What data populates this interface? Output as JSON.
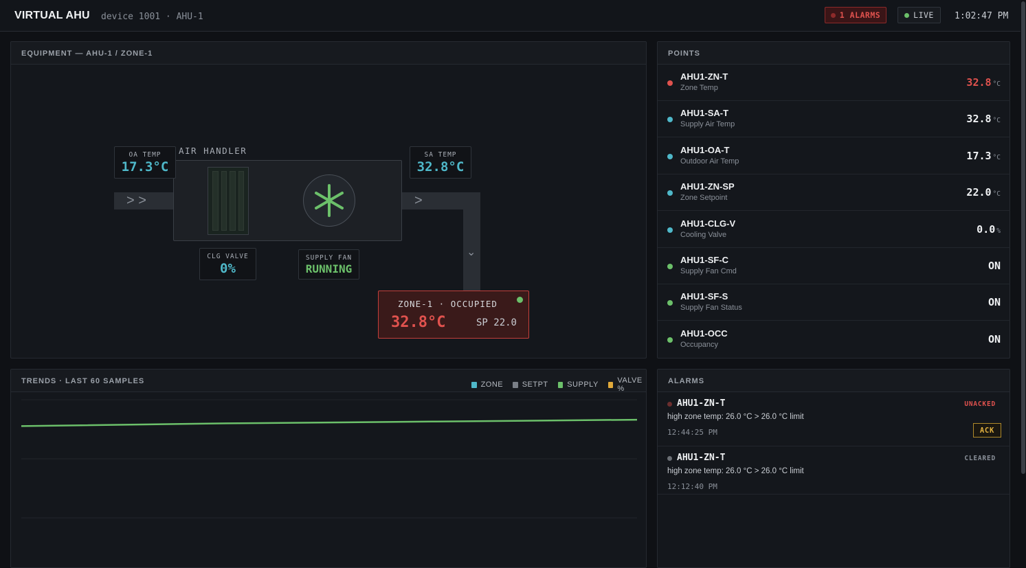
{
  "header": {
    "brand": "VIRTUAL AHU",
    "device": "device 1001 · AHU-1",
    "alarm_pill": "1 ALARMS",
    "live_pill": "LIVE",
    "clock": "1:02:47 PM"
  },
  "equipment": {
    "title": "EQUIPMENT — AHU-1 / ZONE-1",
    "air_handler_label": "AIR HANDLER",
    "oa_temp": {
      "label": "OA TEMP",
      "value": "17.3°C"
    },
    "sa_temp": {
      "label": "SA TEMP",
      "value": "32.8°C"
    },
    "clg_valve": {
      "label": "CLG VALVE",
      "value": "0%"
    },
    "supply_fan": {
      "label": "SUPPLY FAN",
      "value": "RUNNING"
    },
    "zone": {
      "label": "ZONE-1 · OCCUPIED",
      "temp": "32.8°C",
      "setpoint": "SP 22.0"
    }
  },
  "points": {
    "title": "POINTS",
    "items": [
      {
        "name": "AHU1-ZN-T",
        "desc": "Zone Temp",
        "value": "32.8",
        "unit": "°C",
        "dot": "#e0524e",
        "value_color": "#e0524e"
      },
      {
        "name": "AHU1-SA-T",
        "desc": "Supply Air Temp",
        "value": "32.8",
        "unit": "°C",
        "dot": "#4fb8c9",
        "value_color": "#eef0f2"
      },
      {
        "name": "AHU1-OA-T",
        "desc": "Outdoor Air Temp",
        "value": "17.3",
        "unit": "°C",
        "dot": "#4fb8c9",
        "value_color": "#eef0f2"
      },
      {
        "name": "AHU1-ZN-SP",
        "desc": "Zone Setpoint",
        "value": "22.0",
        "unit": "°C",
        "dot": "#4fb8c9",
        "value_color": "#eef0f2"
      },
      {
        "name": "AHU1-CLG-V",
        "desc": "Cooling Valve",
        "value": "0.0",
        "unit": "%",
        "dot": "#4fb8c9",
        "value_color": "#eef0f2"
      },
      {
        "name": "AHU1-SF-C",
        "desc": "Supply Fan Cmd",
        "value": "ON",
        "unit": "",
        "dot": "#6cc06a",
        "value_color": "#eef0f2"
      },
      {
        "name": "AHU1-SF-S",
        "desc": "Supply Fan Status",
        "value": "ON",
        "unit": "",
        "dot": "#6cc06a",
        "value_color": "#eef0f2"
      },
      {
        "name": "AHU1-OCC",
        "desc": "Occupancy",
        "value": "ON",
        "unit": "",
        "dot": "#6cc06a",
        "value_color": "#eef0f2"
      }
    ]
  },
  "trends": {
    "title": "TRENDS · LAST 60 SAMPLES",
    "legend": [
      {
        "name": "ZONE",
        "color": "#4fb8c9"
      },
      {
        "name": "SETPT",
        "color": "#7a7f87"
      },
      {
        "name": "SUPPLY",
        "color": "#6cc06a"
      },
      {
        "name": "VALVE %",
        "color": "#e0a93a"
      }
    ]
  },
  "chart_data": {
    "type": "line",
    "title": "TRENDS · LAST 60 SAMPLES",
    "series": [
      {
        "name": "SUPPLY",
        "color": "#6cc06a",
        "values": [
          32.1,
          32.4,
          32.6,
          32.8
        ]
      }
    ],
    "grid": true
  },
  "alarms": {
    "title": "ALARMS",
    "items": [
      {
        "name": "AHU1-ZN-T",
        "state": "UNACKED",
        "state_color": "#e0524e",
        "dot": "#6b2e2e",
        "message": "high zone temp: 26.0 °C > 26.0 °C limit",
        "time": "12:44:25 PM",
        "ack_label": "ACK"
      },
      {
        "name": "AHU1-ZN-T",
        "state": "CLEARED",
        "state_color": "#8a9099",
        "dot": "#6b6f75",
        "message": "high zone temp: 26.0 °C > 26.0 °C limit",
        "time": "12:12:40 PM"
      }
    ]
  },
  "colors": {
    "accent_cyan": "#4fb8c9",
    "accent_green": "#6cc06a",
    "alarm_red": "#e0524e"
  }
}
